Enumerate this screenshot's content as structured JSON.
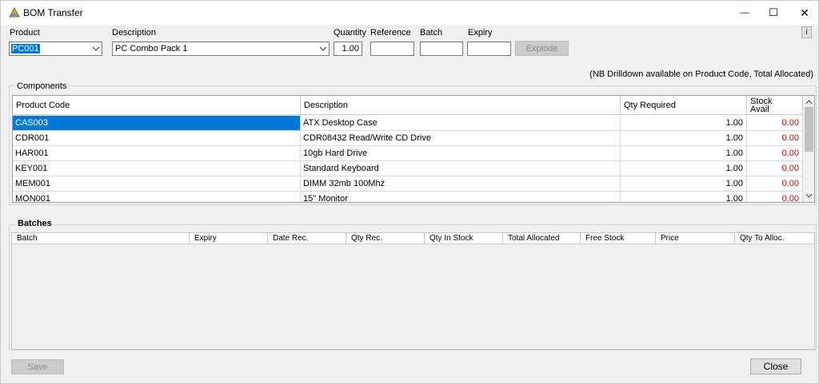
{
  "window": {
    "title": "BOM Transfer",
    "minimize_label": "—",
    "maximize_label": "☐",
    "close_label": "✕"
  },
  "form": {
    "product_label": "Product",
    "product_value": "PC001",
    "description_label": "Description",
    "description_value": "PC Combo Pack 1",
    "quantity_label": "Quantity",
    "quantity_value": "1.00",
    "reference_label": "Reference",
    "reference_value": "",
    "batch_label": "Batch",
    "batch_value": "",
    "expiry_label": "Expiry",
    "expiry_value": "",
    "explode_label": "Explode",
    "info_label": "i"
  },
  "note": "(NB Drilldown available on Product Code, Total Allocated)",
  "components": {
    "title": "Components",
    "columns": [
      "Product Code",
      "Description",
      "Qty Required",
      "Stock Avail"
    ],
    "rows": [
      {
        "code": "CAS003",
        "description": "ATX Desktop Case",
        "qty": "1.00",
        "stock": "0.00"
      },
      {
        "code": "CDR001",
        "description": "CDR08432 Read/Write CD Drive",
        "qty": "1.00",
        "stock": "0.00"
      },
      {
        "code": "HAR001",
        "description": "10gb Hard Drive",
        "qty": "1.00",
        "stock": "0.00"
      },
      {
        "code": "KEY001",
        "description": "Standard Keyboard",
        "qty": "1.00",
        "stock": "0.00"
      },
      {
        "code": "MEM001",
        "description": "DIMM 32mb 100Mhz",
        "qty": "1.00",
        "stock": "0.00"
      },
      {
        "code": "MON001",
        "description": "15\" Monitor",
        "qty": "1.00",
        "stock": "0.00"
      }
    ]
  },
  "batches": {
    "title": "Batches",
    "columns": [
      "Batch",
      "Expiry",
      "Date Rec.",
      "Qty Rec.",
      "Qty In Stock",
      "Total Allocated",
      "Free Stock",
      "Price",
      "Qty To Alloc."
    ]
  },
  "footer": {
    "save_label": "Save",
    "close_label": "Close"
  },
  "colors": {
    "selection": "#0078d7",
    "negative_stock": "#e00000"
  }
}
